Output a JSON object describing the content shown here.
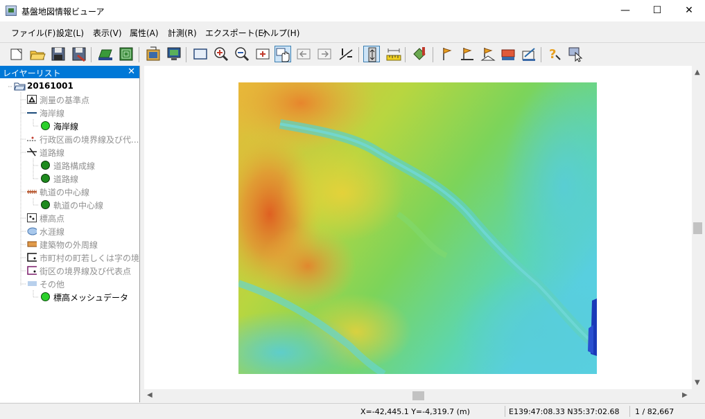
{
  "window": {
    "title": "基盤地図情報ビューア",
    "minimize": "—",
    "maximize": "☐",
    "close": "✕"
  },
  "menu": [
    {
      "label": "ファイル(F)"
    },
    {
      "label": "設定(L)"
    },
    {
      "label": "表示(V)"
    },
    {
      "label": "属性(A)"
    },
    {
      "label": "計測(R)"
    },
    {
      "label": "エクスポート(E)"
    },
    {
      "label": "ヘルプ(H)"
    }
  ],
  "toolbar": {
    "buttons": [
      "new-icon",
      "open-folder-icon",
      "save-icon",
      "save-as-icon",
      "print-icon",
      "layers-icon",
      "import-icon",
      "display-icon",
      "full-extent-icon",
      "zoom-in-icon",
      "zoom-out-icon",
      "zoom-box-icon",
      "pan-hand-icon",
      "back-icon",
      "forward-icon",
      "scale-1-icon",
      "measure-vertical-icon",
      "measure-ruler-icon",
      "bucket-icon",
      "flag-1-icon",
      "flag-2-icon",
      "flag-3-icon",
      "export-1-icon",
      "export-2-icon",
      "help-icon",
      "query-icon"
    ]
  },
  "layer_panel": {
    "title": "レイヤーリスト",
    "close": "✕",
    "root": "20161001",
    "items": [
      {
        "label": "測量の基準点",
        "level": 1,
        "enabled": false,
        "icon": "triangle-point-icon"
      },
      {
        "label": "海岸線",
        "level": 1,
        "enabled": false,
        "icon": "line-blue-icon"
      },
      {
        "label": "海岸線",
        "level": 2,
        "enabled": true,
        "icon": "green-circle-icon"
      },
      {
        "label": "行政区画の境界線及び代...",
        "level": 1,
        "enabled": false,
        "icon": "boundary-line-icon"
      },
      {
        "label": "道路線",
        "level": 1,
        "enabled": false,
        "icon": "road-line-icon"
      },
      {
        "label": "道路構成線",
        "level": 2,
        "enabled": true,
        "icon": "dark-green-circle-icon"
      },
      {
        "label": "道路線",
        "level": 2,
        "enabled": true,
        "icon": "dark-green-circle-icon"
      },
      {
        "label": "軌道の中心線",
        "level": 1,
        "enabled": false,
        "icon": "rail-line-icon"
      },
      {
        "label": "軌道の中心線",
        "level": 2,
        "enabled": true,
        "icon": "dark-green-circle-icon"
      },
      {
        "label": "標高点",
        "level": 1,
        "enabled": false,
        "icon": "elevation-point-icon"
      },
      {
        "label": "水涯線",
        "level": 1,
        "enabled": false,
        "icon": "water-icon"
      },
      {
        "label": "建築物の外周線",
        "level": 1,
        "enabled": false,
        "icon": "building-icon"
      },
      {
        "label": "市町村の町若しくは字の境...",
        "level": 1,
        "enabled": false,
        "icon": "town-boundary-icon"
      },
      {
        "label": "街区の境界線及び代表点",
        "level": 1,
        "enabled": false,
        "icon": "block-boundary-icon"
      },
      {
        "label": "その他",
        "level": 1,
        "enabled": false,
        "icon": "other-icon"
      },
      {
        "label": "標高メッシュデータ",
        "level": 2,
        "enabled": true,
        "icon": "green-circle-icon"
      }
    ]
  },
  "status": {
    "xy": "X=-42,445.1 Y=-4,319.7 (m)",
    "latlon": "E139:47:08.33 N35:37:02.68",
    "scale": "1 / 82,667"
  }
}
